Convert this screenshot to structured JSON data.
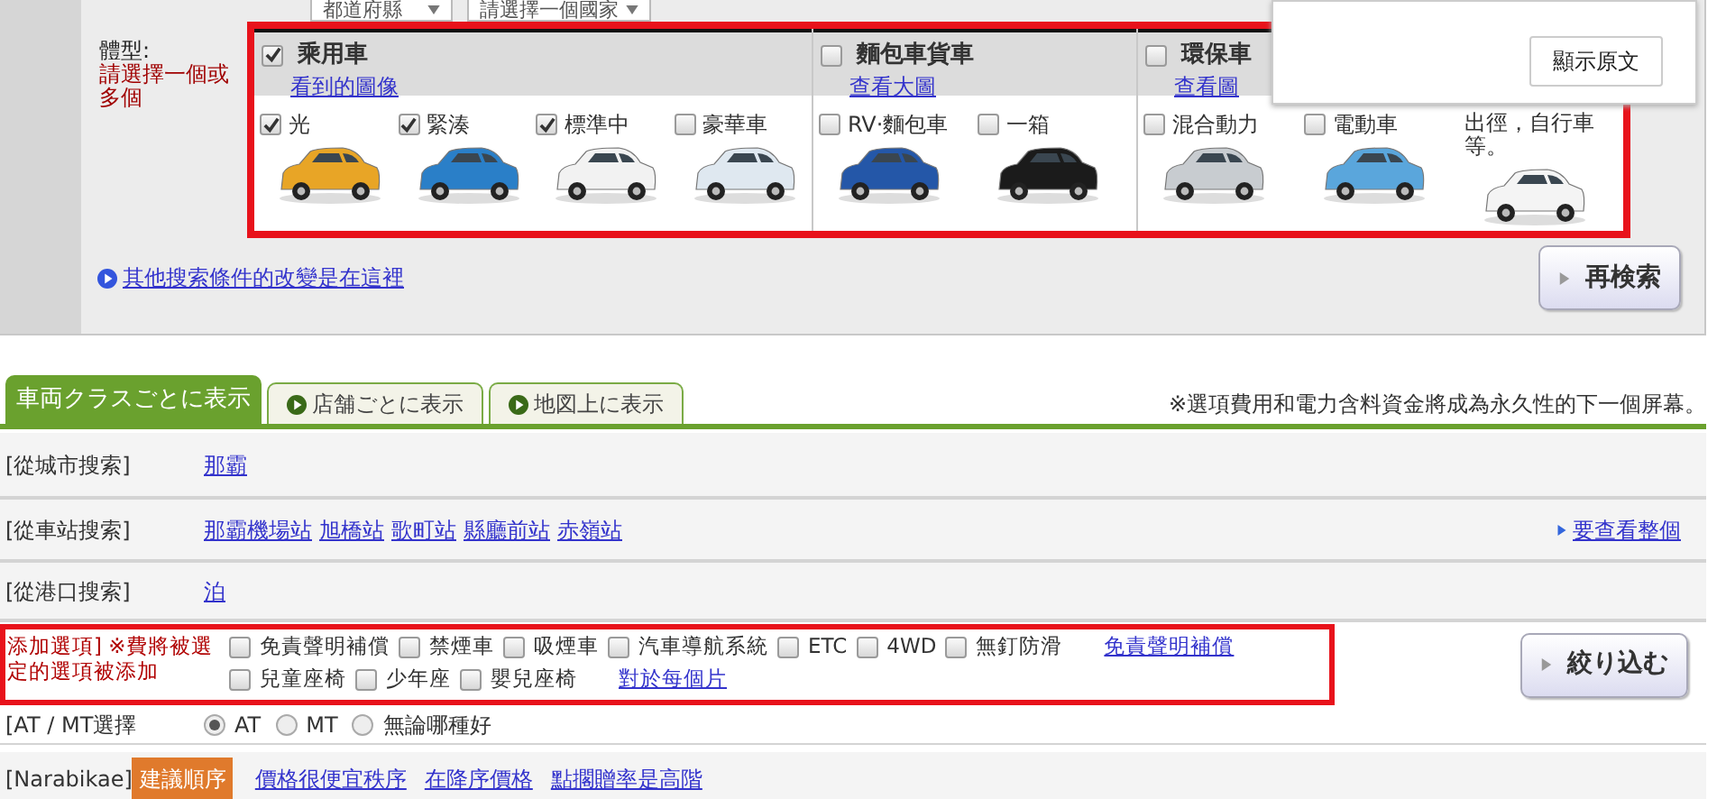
{
  "filters": {
    "prefecture_select": "都道府縣",
    "country_select": "請選擇一個國家"
  },
  "body_type": {
    "label": "體型:",
    "hint": "請選擇一個或多個"
  },
  "car_groups": [
    {
      "title": "乘用車",
      "checked": true,
      "link": "看到的圖像",
      "items": [
        {
          "kind": "checkbox",
          "label": "光",
          "checked": true
        },
        {
          "kind": "checkbox",
          "label": "緊湊",
          "checked": true
        },
        {
          "kind": "checkbox",
          "label": "標準中",
          "checked": true
        },
        {
          "kind": "checkbox",
          "label": "豪華車",
          "checked": false
        }
      ]
    },
    {
      "title": "麵包車貨車",
      "checked": false,
      "link": "查看大圖",
      "items": [
        {
          "kind": "checkbox",
          "label": "RV·麵包車",
          "checked": false
        },
        {
          "kind": "checkbox",
          "label": "一箱",
          "checked": false
        }
      ]
    },
    {
      "title": "環保車",
      "checked": false,
      "link": "查看圖",
      "items": [
        {
          "kind": "checkbox",
          "label": "混合動力",
          "checked": false
        },
        {
          "kind": "checkbox",
          "label": "電動車",
          "checked": false
        },
        {
          "kind": "text",
          "label": "出徑，自行車等。"
        }
      ]
    }
  ],
  "popup": {
    "button": "顯示原文"
  },
  "more_link": "其他搜索條件的改變是在這裡",
  "research_button": "再検索",
  "tabs": [
    {
      "label": "車両クラスごとに表示",
      "selected": true
    },
    {
      "label": "店舗ごとに表示",
      "selected": false
    },
    {
      "label": "地図上に表示",
      "selected": false
    }
  ],
  "note": "※選項費用和電力含料資金將成為永久性的下一個屏幕。",
  "search_rows": [
    {
      "label": "[從城市搜索]",
      "links": [
        "那霸"
      ]
    },
    {
      "label": "[從車站搜索]",
      "links": [
        "那霸機場站",
        "旭橋站",
        "歌町站",
        "縣廳前站",
        "赤嶺站"
      ],
      "more": "要查看整個"
    },
    {
      "label": "[從港口搜索]",
      "links": [
        "泊"
      ]
    }
  ],
  "options": {
    "label": "添加選項] ※費將被選定的選項被添加",
    "lines": [
      [
        {
          "kind": "checkbox",
          "label": "免責聲明補償",
          "checked": false
        },
        {
          "kind": "checkbox",
          "label": "禁煙車",
          "checked": false
        },
        {
          "kind": "checkbox",
          "label": "吸煙車",
          "checked": false
        },
        {
          "kind": "checkbox",
          "label": "汽車導航系統",
          "checked": false
        },
        {
          "kind": "checkbox",
          "label": "ETC",
          "checked": false
        },
        {
          "kind": "checkbox",
          "label": "4WD",
          "checked": false
        },
        {
          "kind": "checkbox",
          "label": "無釘防滑",
          "checked": false
        },
        {
          "kind": "link",
          "label": "免責聲明補償"
        }
      ],
      [
        {
          "kind": "checkbox",
          "label": "兒童座椅",
          "checked": false
        },
        {
          "kind": "checkbox",
          "label": "少年座",
          "checked": false
        },
        {
          "kind": "checkbox",
          "label": "嬰兒座椅",
          "checked": false
        },
        {
          "kind": "link",
          "label": "對於每個片"
        }
      ]
    ]
  },
  "filter_button": "絞り込む",
  "transmission": {
    "label": "[AT / MT選擇",
    "choices": [
      {
        "label": "AT",
        "selected": true
      },
      {
        "label": "MT",
        "selected": false
      },
      {
        "label": "無論哪種好",
        "selected": false
      }
    ]
  },
  "sort": {
    "label": "[Narabikae]",
    "options": [
      {
        "label": "建議順序",
        "selected": true
      },
      {
        "label": "價格很便宜秩序",
        "selected": false
      },
      {
        "label": "在降序價格",
        "selected": false
      },
      {
        "label": "點擱贈率是高階",
        "selected": false
      }
    ]
  }
}
